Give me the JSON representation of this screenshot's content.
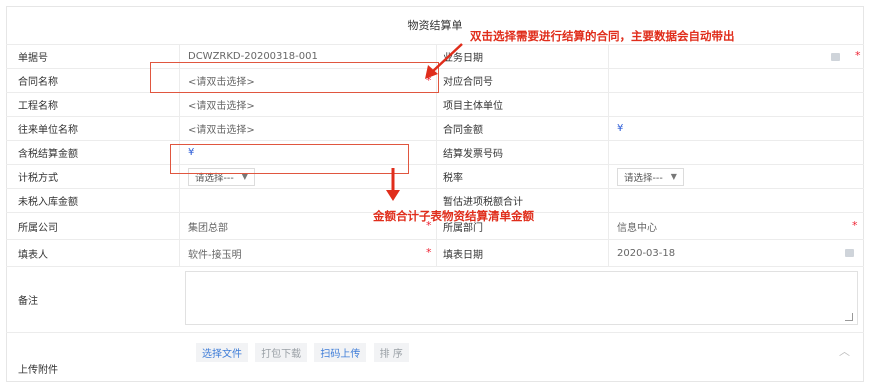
{
  "form": {
    "title": "物资结算单",
    "rows": [
      {
        "l1": "单据号",
        "v1": "DCWZRKD-20200318-001",
        "l2": "业务日期",
        "v2": ""
      },
      {
        "l1": "合同名称",
        "v1": "<请双击选择>",
        "l2": "对应合同号",
        "v2": ""
      },
      {
        "l1": "工程名称",
        "v1": "<请双击选择>",
        "l2": "项目主体单位",
        "v2": ""
      },
      {
        "l1": "往来单位名称",
        "v1": "<请双击选择>",
        "l2": "合同金额",
        "v2": "¥"
      },
      {
        "l1": "含税结算金额",
        "v1": "¥",
        "l2": "结算发票号码",
        "v2": ""
      },
      {
        "l1": "计税方式",
        "v1": "请选择---",
        "l2": "税率",
        "v2": "请选择---"
      },
      {
        "l1": "未税入库金额",
        "v1": "",
        "l2": "暂估进项税额合计",
        "v2": ""
      },
      {
        "l1": "所属公司",
        "v1": "集团总部",
        "l2": "所属部门",
        "v2": "信息中心"
      },
      {
        "l1": "填表人",
        "v1": "软件-接玉明",
        "l2": "填表日期",
        "v2": "2020-03-18"
      }
    ],
    "remark_label": "备注",
    "attach_label": "上传附件",
    "buttons": {
      "choose": "选择文件",
      "pack": "打包下载",
      "scan": "扫码上传",
      "sort": "排 序"
    }
  },
  "annotations": {
    "top": "双击选择需要进行结算的合同，主要数据会自动带出",
    "bottom": "金额合计子表物资结算清单金额"
  },
  "colors": {
    "annotation": "#e02d1b",
    "link_blue": "#3f7dd8",
    "currency_blue": "#2a5bd7"
  }
}
